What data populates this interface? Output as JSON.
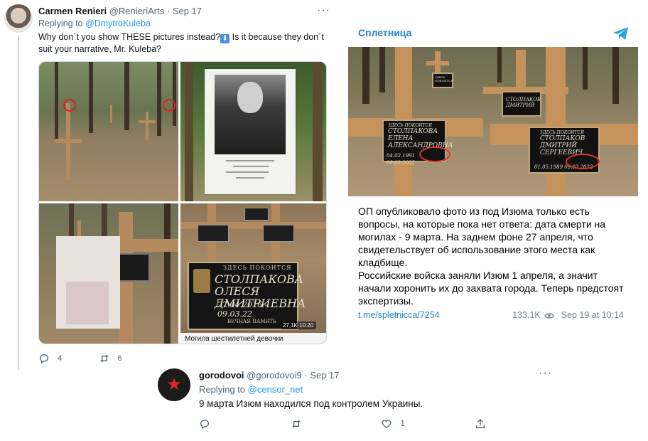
{
  "tweet1": {
    "author_name": "Carmen Renieri",
    "author_handle": "@RenieriArts",
    "separator": "·",
    "date": "Sep 17",
    "more": "···",
    "replying_prefix": "Replying to",
    "replying_handle": "@DmytroKuleba",
    "text_part1": "Why don´t you show THESE pictures instead?",
    "text_arrow": "⬇",
    "text_part2": " Is it because they don´t suit your narrative, Mr. Kuleba?",
    "media": {
      "portrait_sign": "......",
      "plaque_header": "ЗДЕСЬ ПОКОИТСЯ",
      "plaque_name": "СТОЛПАКОВА ОЛЕСЯ ДМИТРИЕВНА",
      "plaque_dates": "27.04.2016 - 09.03.22",
      "plaque_memory": "ВЕЧНАЯ ПАМЯТЬ",
      "view_count": "27,1K 10:20",
      "caption": "Могила шестилетней девочки"
    },
    "actions": {
      "reply_count": "4",
      "retweet_count": "6"
    }
  },
  "telegram": {
    "channel": "Сплетница",
    "photo": {
      "plaque1_header": "ЗДЕСЬ ПОКОИТСЯ",
      "plaque1_name": "СТОЛПАКОВА ЕЛЕНА АЛЕКСАНДРОВНА",
      "plaque1_dates": "04.02.1991  09.03.2022",
      "plaque2_header": "ЗДЕСЬ ПОКОИТСЯ",
      "plaque2_name": "СТОЛПАКОВ ДМИТРИЙ СЕРГЕЕВИЧ",
      "plaque2_dates": "01.05.1989  09.03.2022",
      "plaque3_name": "СТОЛПАКОВ ДМИТРИЙ",
      "plaque4_header": "ЗДЕСЬ ПОКОИТСЯ"
    },
    "text": "ОП опубликовало фото из под Изюма только есть вопросы, на которые пока нет ответа: дата смерти на могилах - 9 марта. На заднем фоне 27 апреля, что свидетельствует об использование этого места как кладбище.\nРоссийские войска заняли Изюм 1 апреля, а значит начали хоронить их до захвата города. Теперь предстоят экспертизы.",
    "link": "t.me/spletnicca/7254",
    "views": "133.1K",
    "date": "Sep 19 at 10:14"
  },
  "tweet2": {
    "author_name": "gorodovoi",
    "author_handle": "@gorodovoi9",
    "separator": "·",
    "date": "Sep 17",
    "more": "···",
    "avatar_symbol": "★",
    "replying_prefix": "Replying to",
    "replying_handle": "@censor_net",
    "text": "9 марта Изюм находился под контролем Украины.",
    "actions": {
      "like_count": "1"
    }
  },
  "colors": {
    "twitter_blue": "#1d9bf0",
    "telegram_blue": "#2481cc",
    "secondary_text": "#536471",
    "highlight_red": "#e02020"
  },
  "icons": [
    "reply-icon",
    "retweet-icon",
    "like-icon",
    "share-icon",
    "views-eye-icon",
    "telegram-logo-icon",
    "more-icon"
  ]
}
